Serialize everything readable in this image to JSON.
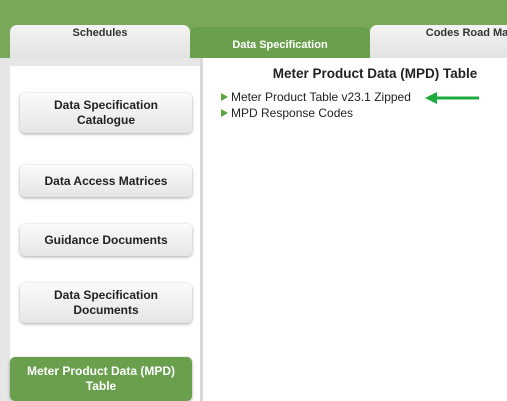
{
  "tabs": {
    "schedules": "Schedules",
    "data_specification": "Data Specification",
    "codes_road_map": "Codes Road Map"
  },
  "sidebar": {
    "items": [
      {
        "label": "Data Specification Catalogue"
      },
      {
        "label": "Data Access Matrices"
      },
      {
        "label": "Guidance Documents"
      },
      {
        "label": "Data Specification Documents"
      },
      {
        "label": "Meter Product Data (MPD) Table"
      }
    ]
  },
  "main": {
    "title": "Meter Product Data (MPD) Table",
    "links": [
      {
        "label": "Meter Product Table v23.1 Zipped"
      },
      {
        "label": "MPD Response Codes"
      }
    ]
  },
  "colors": {
    "header_green": "#7aa85a",
    "active_green": "#6aa04d",
    "arrow_green": "#1eaa3c"
  }
}
